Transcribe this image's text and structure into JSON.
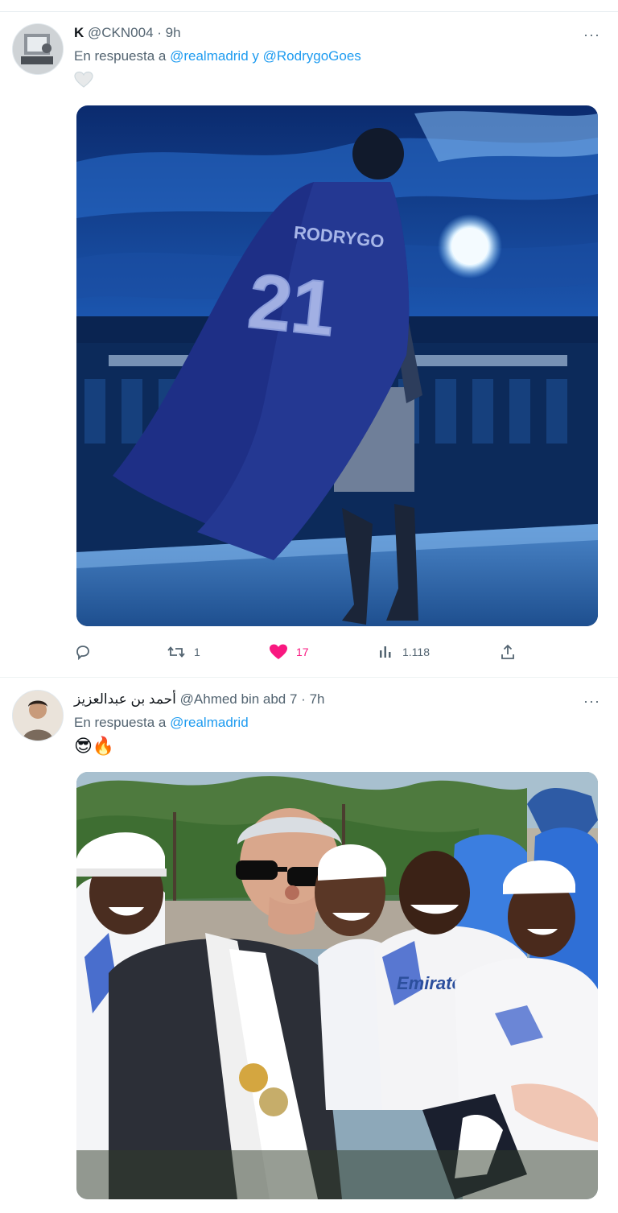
{
  "tweets": [
    {
      "name": "K",
      "handle": "@CKN004",
      "dot": "·",
      "time": "9h",
      "reply_prefix": "En respuesta a",
      "mention_1": "@realmadrid",
      "conj": "y",
      "mention_2": "@RodrygoGoes",
      "more": "···",
      "image_text_name": "RODRYGO",
      "image_text_number": "21",
      "actions": {
        "reply_count": "",
        "retweet_count": "1",
        "like_count": "17",
        "views_count": "1.118"
      },
      "icons": [
        "like-heart-outline-icon",
        "reply-icon",
        "retweet-icon",
        "like-heart-filled-icon",
        "views-icon",
        "share-icon"
      ]
    },
    {
      "name": "أحمد بن عبدالعزيز",
      "handle": "@Ahmed bin abd 7",
      "dot": "·",
      "time": "7h",
      "reply_prefix": "En respuesta a",
      "mention_1": "@realmadrid",
      "emoji_text": "😎🔥",
      "more": "···",
      "image_shirt_text": "Emirates"
    }
  ],
  "colors": {
    "link": "#1d9bf0",
    "muted": "#536471",
    "like": "#f91880",
    "separator": "#eff3f4"
  }
}
